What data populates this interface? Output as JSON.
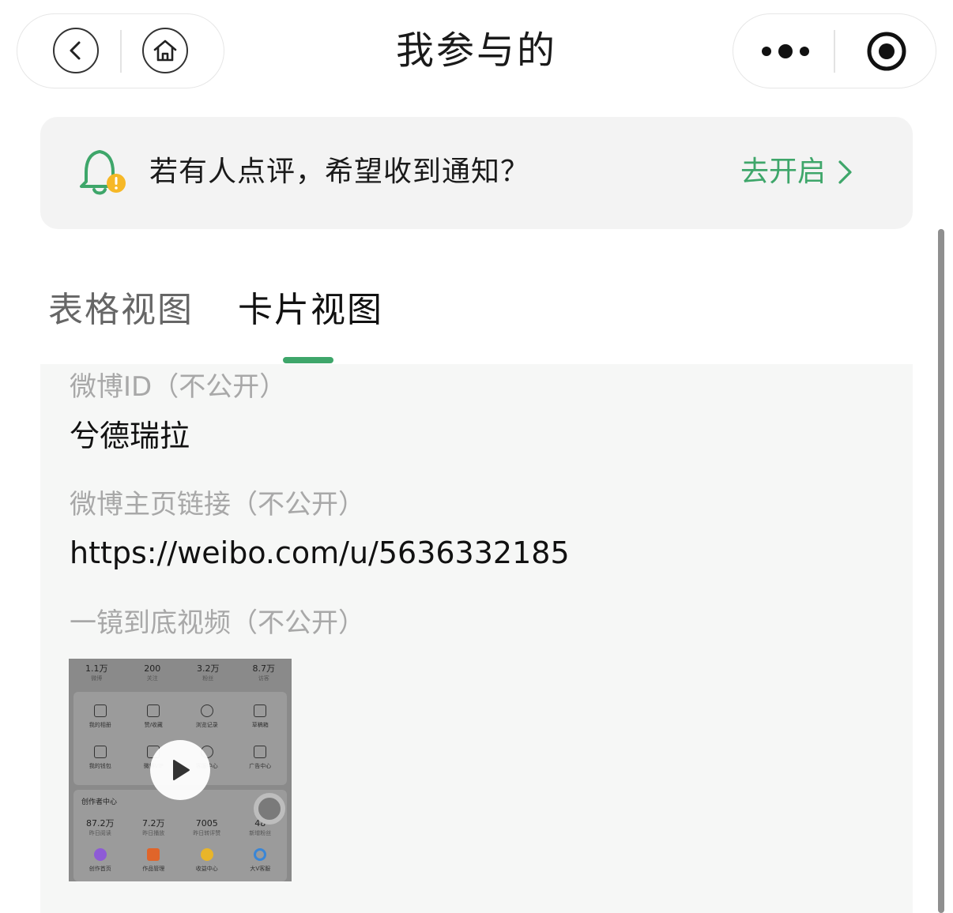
{
  "nav": {
    "title": "我参与的",
    "back_icon": "chevron-left-icon",
    "home_icon": "home-icon",
    "more_icon": "more-dots-icon",
    "close_icon": "target-icon"
  },
  "notice": {
    "icon": "bell-warning-icon",
    "text": "若有人点评，希望收到通知？",
    "action_label": "去开启",
    "accent": "#3ea66a"
  },
  "tabs": [
    {
      "label": "表格视图",
      "active": false
    },
    {
      "label": "卡片视图",
      "active": true
    }
  ],
  "card": {
    "fields": [
      {
        "label": "微博ID（不公开）",
        "value": "兮德瑞拉"
      },
      {
        "label": "微博主页链接（不公开）",
        "value": "https://weibo.com/u/5636332185"
      },
      {
        "label": "一镜到底视频（不公开）"
      }
    ],
    "video_thumb": {
      "stats": [
        {
          "num": "1.1万",
          "sub": "微博"
        },
        {
          "num": "200",
          "sub": "关注"
        },
        {
          "num": "3.2万",
          "sub": "粉丝"
        },
        {
          "num": "8.7万",
          "sub": "访客"
        }
      ],
      "row1": [
        "我的相册",
        "赞/收藏",
        "浏览记录",
        "草稿箱"
      ],
      "row2": [
        "我的钱包",
        "微博VIP",
        "客服中心",
        "广告中心"
      ],
      "creator_title": "创作者中心",
      "creator_stats": [
        {
          "num": "87.2万",
          "sub": "昨日阅读"
        },
        {
          "num": "7.2万",
          "sub": "昨日播放"
        },
        {
          "num": "7005",
          "sub": "昨日转评赞"
        },
        {
          "num": "48",
          "sub": "新增粉丝"
        }
      ],
      "row3": [
        "创作首页",
        "作品管理",
        "收益中心",
        "大V客服"
      ],
      "play_icon": "play-icon"
    }
  }
}
